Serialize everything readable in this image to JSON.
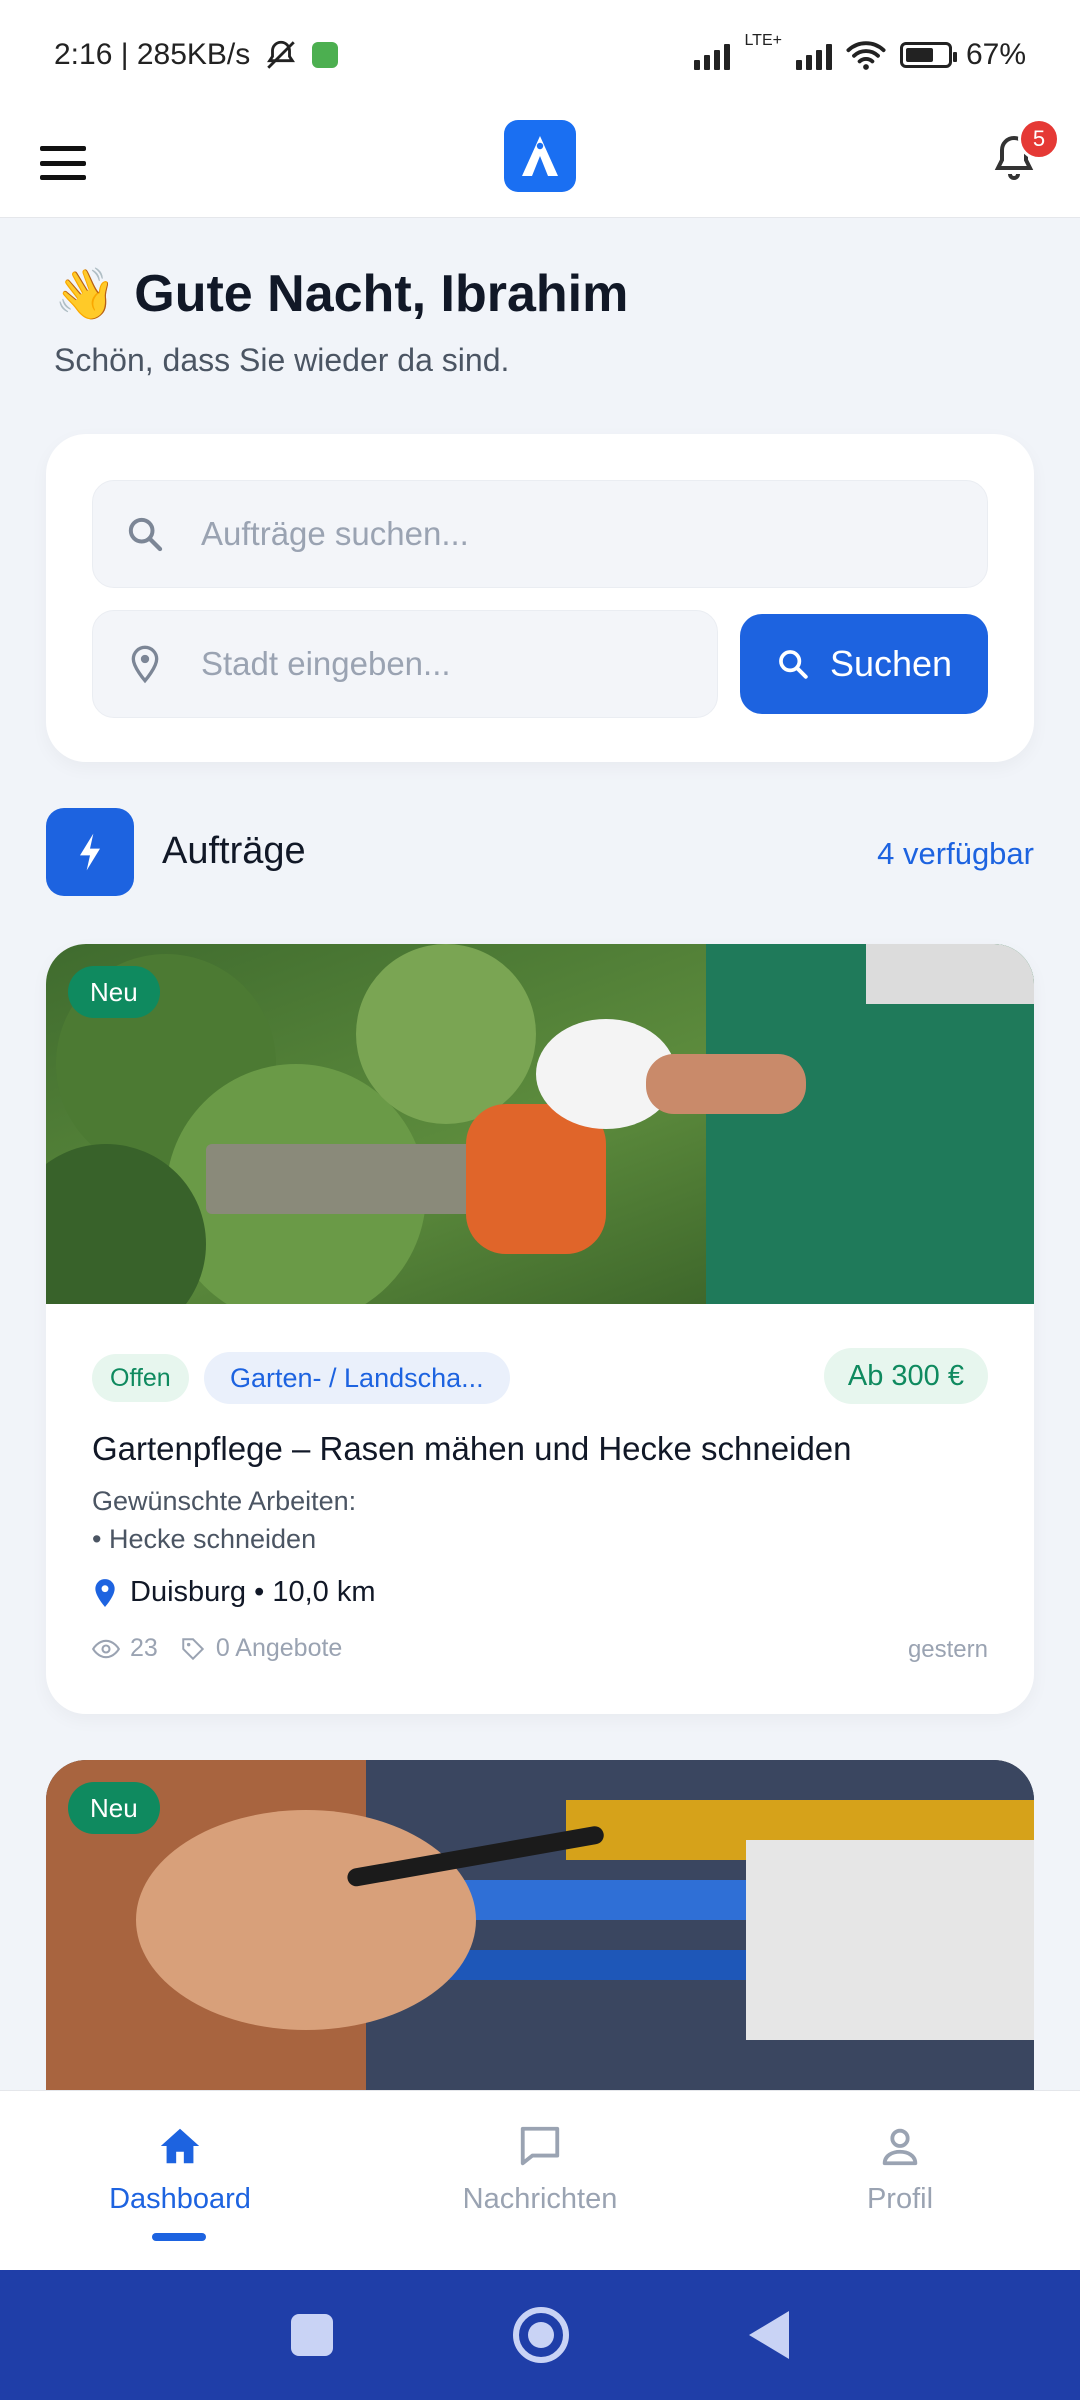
{
  "status_bar": {
    "time_speed": "2:16 | 285KB/s",
    "network_label": "LTE+",
    "battery": "67%"
  },
  "header": {
    "notification_count": "5"
  },
  "greeting": {
    "emoji": "👋",
    "title": "Gute Nacht, Ibrahim",
    "subtitle": "Schön, dass Sie wieder da sind."
  },
  "search": {
    "query_placeholder": "Aufträge suchen...",
    "city_placeholder": "Stadt eingeben...",
    "button_label": "Suchen"
  },
  "section": {
    "title": "Aufträge",
    "count_label": "4 verfügbar"
  },
  "jobs": [
    {
      "badge": "Neu",
      "status": "Offen",
      "category": "Garten- / Landscha...",
      "price": "Ab 300 €",
      "title": "Gartenpflege – Rasen mähen und Hecke schneiden",
      "desc_line1": "Gewünschte Arbeiten:",
      "desc_line2": "• Hecke schneiden",
      "location": "Duisburg • 10,0 km",
      "views": "23",
      "offers": "0 Angebote",
      "date": "gestern"
    },
    {
      "badge": "Neu"
    }
  ],
  "bottom_nav": [
    {
      "label": "Dashboard",
      "icon": "home-icon",
      "active": true
    },
    {
      "label": "Nachrichten",
      "icon": "chat-icon",
      "active": false
    },
    {
      "label": "Profil",
      "icon": "person-icon",
      "active": false
    }
  ],
  "colors": {
    "primary": "#1d63e0",
    "success": "#0f8a5f",
    "badge": "#e53935",
    "system_nav": "#1f3ea8"
  }
}
